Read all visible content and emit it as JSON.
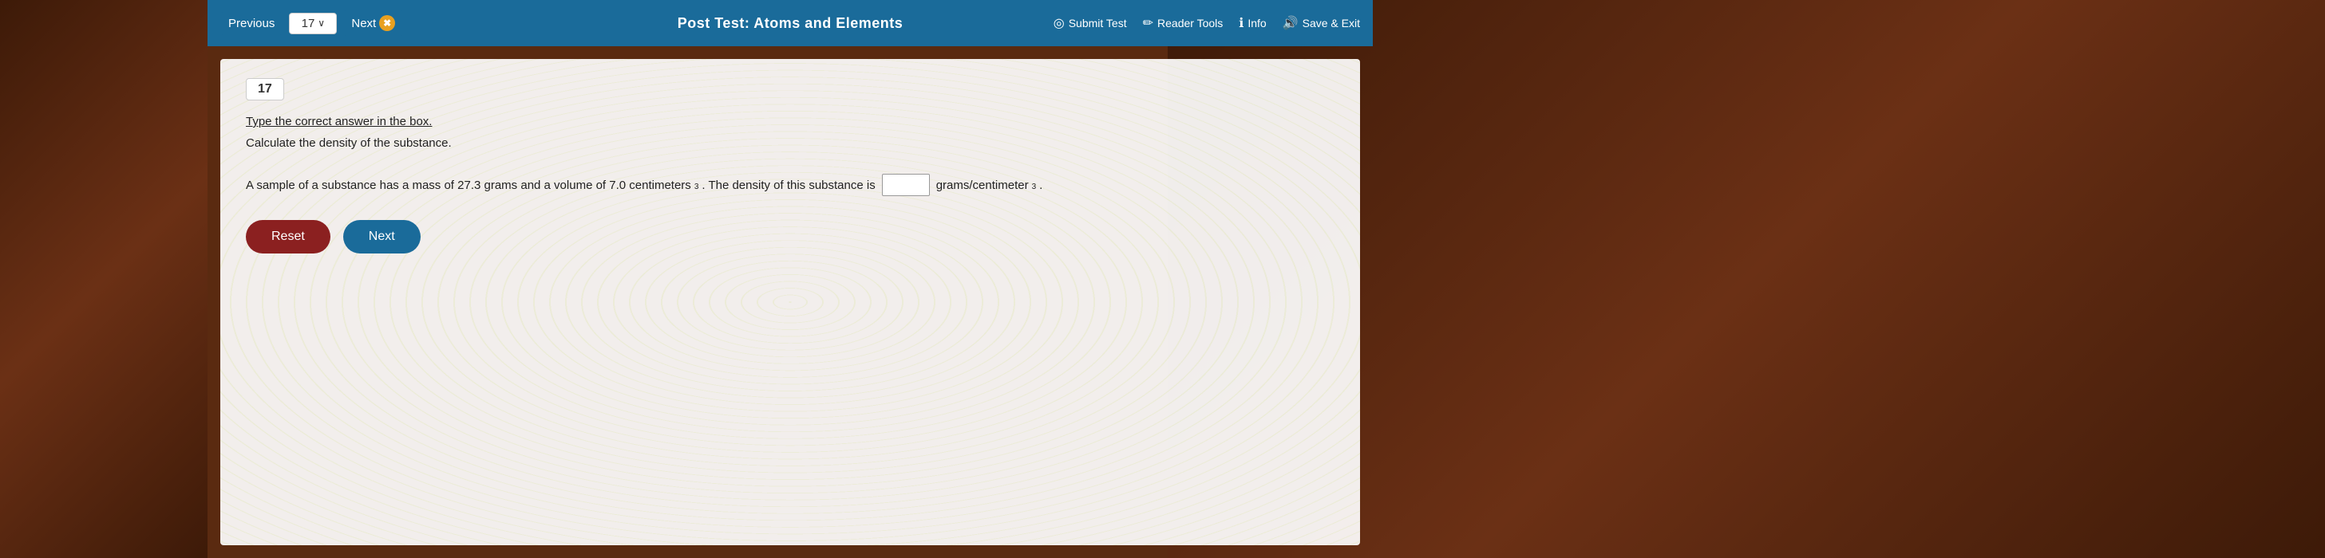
{
  "nav": {
    "prev_label": "Previous",
    "next_label": "Next",
    "question_number": "17",
    "chevron_down": "∨",
    "test_title": "Post Test: Atoms and Elements",
    "submit_test_label": "Submit Test",
    "reader_tools_label": "Reader Tools",
    "info_label": "Info",
    "save_exit_label": "Save & Exit",
    "next_icon": "✖"
  },
  "question": {
    "number": "17",
    "instruction": "Type the correct answer in the box.",
    "description": "Calculate the density of the substance.",
    "problem_part1": "A sample of a substance has a mass of 27.3 grams and a volume of 7.0 centimeters",
    "problem_exponent": "3",
    "problem_part2": ". The density of this substance is",
    "problem_unit": "grams/centimeter",
    "problem_unit_exp": "3",
    "answer_placeholder": "",
    "reset_label": "Reset",
    "next_label": "Next"
  }
}
